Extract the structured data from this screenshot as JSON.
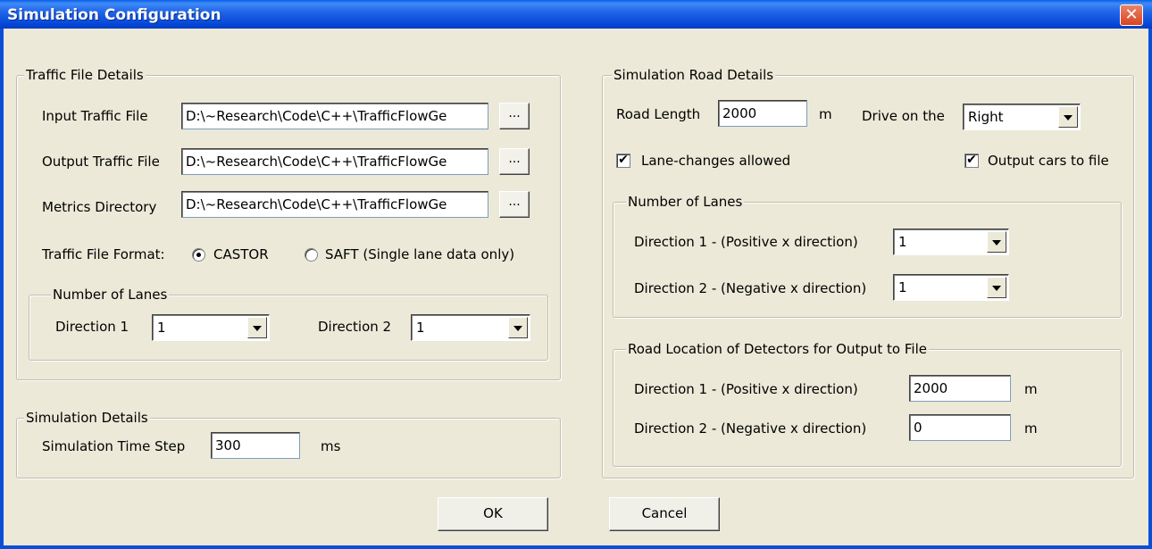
{
  "window": {
    "title": "Simulation Configuration",
    "close_glyph": "✕"
  },
  "traffic_file_details": {
    "legend": "Traffic File Details",
    "input_label": "Input Traffic File",
    "input_value": "D:\\~Research\\Code\\C++\\TrafficFlowGe",
    "output_label": "Output Traffic File",
    "output_value": "D:\\~Research\\Code\\C++\\TrafficFlowGe",
    "metrics_label": "Metrics Directory",
    "metrics_value": "D:\\~Research\\Code\\C++\\TrafficFlowGe",
    "browse_label": "...",
    "format_label": "Traffic File Format:",
    "format_options": [
      "CASTOR",
      "SAFT (Single lane data only)"
    ],
    "format_selected": "CASTOR",
    "lanes": {
      "legend": "Number of Lanes",
      "dir1_label": "Direction 1",
      "dir1_value": "1",
      "dir2_label": "Direction 2",
      "dir2_value": "1"
    }
  },
  "simulation_details": {
    "legend": "Simulation Details",
    "timestep_label": "Simulation Time Step",
    "timestep_value": "300",
    "timestep_unit": "ms"
  },
  "road_details": {
    "legend": "Simulation Road Details",
    "road_length_label": "Road Length",
    "road_length_value": "2000",
    "road_length_unit": "m",
    "drive_label": "Drive on the",
    "drive_value": "Right",
    "lane_changes_label": "Lane-changes allowed",
    "lane_changes_checked": true,
    "output_cars_label": "Output cars to file",
    "output_cars_checked": true,
    "check_glyph": "✔",
    "lanes": {
      "legend": "Number of Lanes",
      "dir1_label": "Direction 1 - (Positive x direction)",
      "dir1_value": "1",
      "dir2_label": "Direction 2 - (Negative x direction)",
      "dir2_value": "1"
    },
    "detectors": {
      "legend": "Road Location of Detectors for Output to File",
      "dir1_label": "Direction 1 - (Positive x direction)",
      "dir1_value": "2000",
      "dir1_unit": "m",
      "dir2_label": "Direction 2 - (Negative x direction)",
      "dir2_value": "0",
      "dir2_unit": "m"
    }
  },
  "buttons": {
    "ok": "OK",
    "cancel": "Cancel"
  }
}
